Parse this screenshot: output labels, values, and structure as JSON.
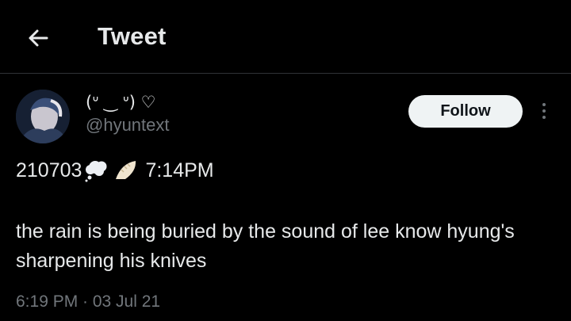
{
  "header": {
    "title": "Tweet",
    "back_icon": "arrow-left-icon"
  },
  "author": {
    "display_name": "(ᐡ ‿ ᐡ) ♡",
    "handle": "@hyuntext",
    "avatar_icon": "avatar"
  },
  "actions": {
    "follow_label": "Follow",
    "more_icon": "more-vertical-icon"
  },
  "tweet": {
    "prefix": "210703",
    "emojis": [
      "thought-bubble-icon",
      "dumpling-icon"
    ],
    "time": "7:14PM",
    "text": "the rain is being buried by the sound of lee know hyung's sharpening his knives",
    "posted_at": "6:19 PM · 03 Jul 21"
  },
  "colors": {
    "background": "#000000",
    "text_primary": "#e7e9ea",
    "text_secondary": "#71767b",
    "divider": "#2f3336",
    "follow_bg": "#eff3f4",
    "follow_text": "#0f1419"
  }
}
